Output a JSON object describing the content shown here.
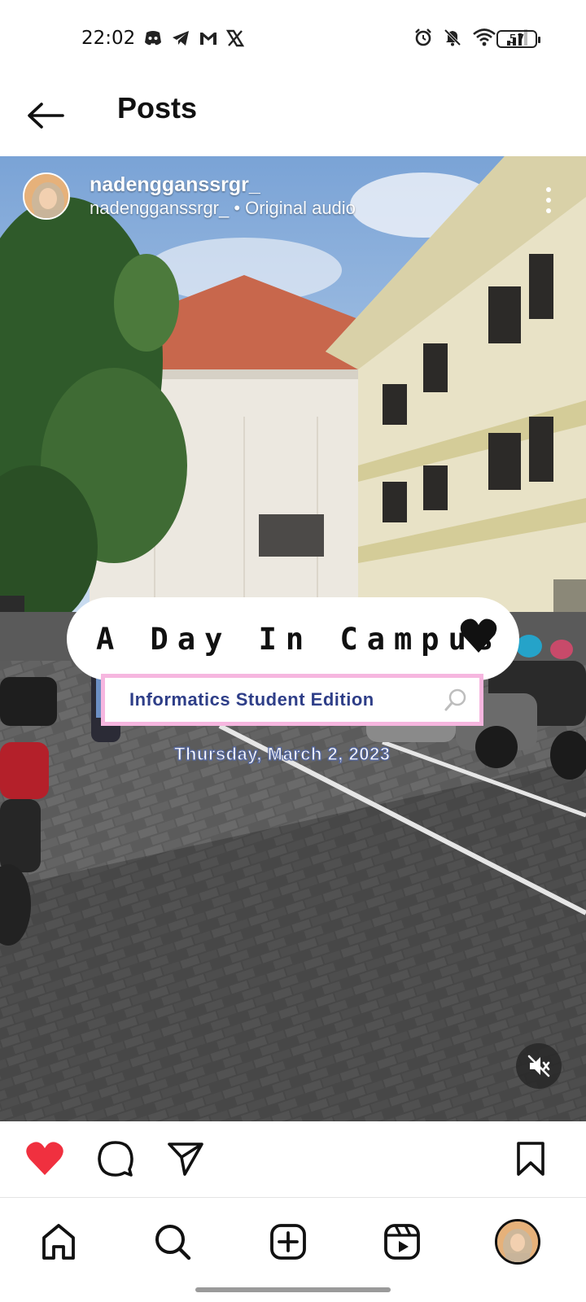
{
  "status_bar": {
    "time": "22:02",
    "battery": "57",
    "left_icons": [
      "discord-icon",
      "telegram-icon",
      "gmail-icon",
      "x-icon"
    ],
    "right_icons": [
      "alarm-icon",
      "bell-off-icon",
      "wifi-icon",
      "signal-icon",
      "battery-icon"
    ]
  },
  "header": {
    "title": "Posts"
  },
  "post": {
    "author": "nadengganssrgr_",
    "subtitle": "nadengganssrgr_ • Original audio",
    "caption_title": "A Day In Campus",
    "sticker_text": "Informatics Student Edition",
    "date_text": "Thursday, March 2, 2023",
    "liked": true
  },
  "colors": {
    "like_red": "#f0303f",
    "sticker_pink": "#f6b6df",
    "sticker_text": "#2e3e88"
  },
  "bottom_nav": {
    "items": [
      "home-icon",
      "search-icon",
      "create-icon",
      "reels-icon",
      "profile-avatar"
    ]
  }
}
